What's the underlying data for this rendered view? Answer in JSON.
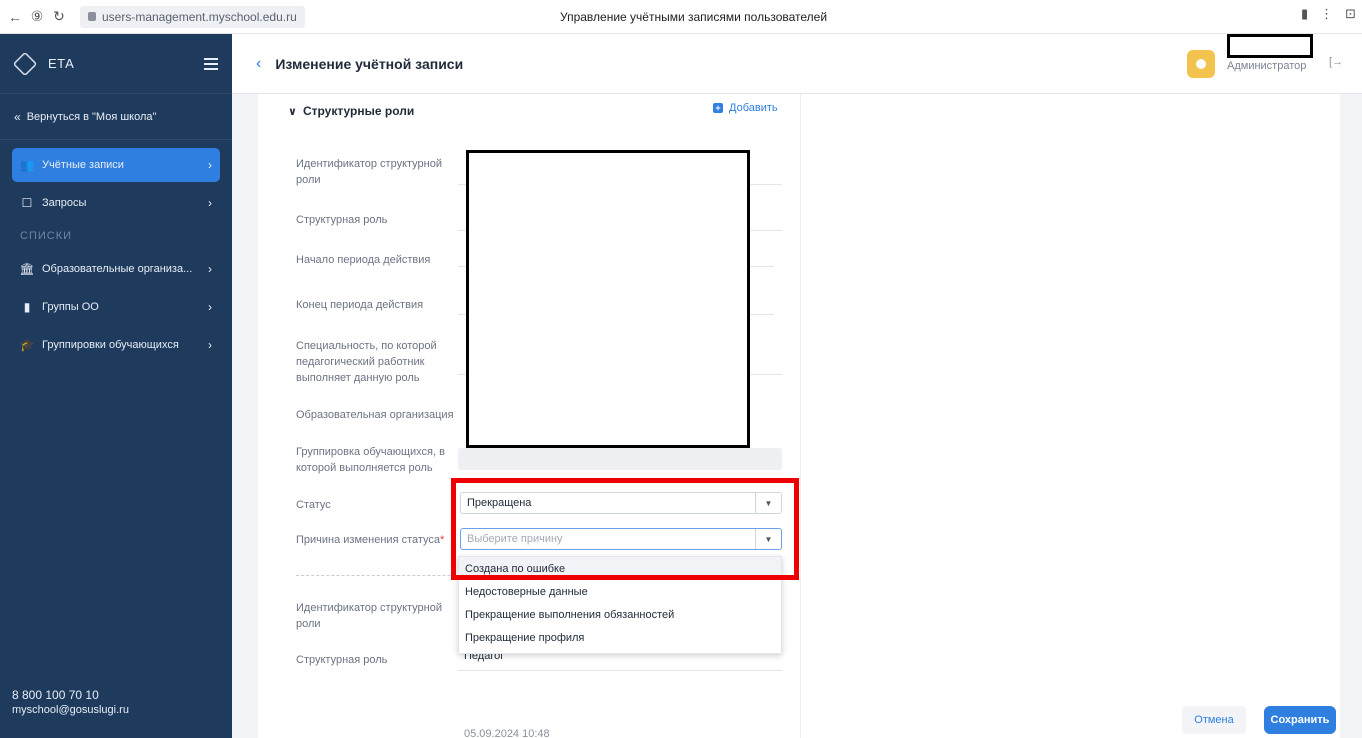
{
  "browser": {
    "url": "users-management.myschool.edu.ru",
    "title": "Управление учётными записями пользователей"
  },
  "sidebar": {
    "logo_text": "ЕТА",
    "back_link": "Вернуться в \"Моя школа\"",
    "items": [
      {
        "label": "Учётные записи",
        "icon": "users-icon",
        "active": true
      },
      {
        "label": "Запросы",
        "icon": "inbox-icon",
        "active": false
      }
    ],
    "section_label": "СПИСКИ",
    "list_items": [
      {
        "label": "Образовательные организа...",
        "icon": "institution-icon"
      },
      {
        "label": "Группы ОО",
        "icon": "bookmark-icon"
      },
      {
        "label": "Группировки обучающихся",
        "icon": "graduation-cap-icon"
      }
    ],
    "contacts": {
      "phone": "8 800 100 70 10",
      "email": "myschool@gosuslugi.ru"
    }
  },
  "header": {
    "title": "Изменение учётной записи",
    "user_role": "Администратор"
  },
  "section": {
    "title": "Структурные роли",
    "add_label": "Добавить"
  },
  "fields": {
    "role_id": "Идентификатор структурной роли",
    "role": "Структурная роль",
    "start": "Начало периода действия",
    "end": "Конец периода действия",
    "speciality": "Специальность, по которой педагогический работник выполняет данную роль",
    "organization": "Образовательная организация",
    "grouping": "Группировка обучающихся, в которой выполняется роль",
    "status": "Статус",
    "reason": "Причина изменения статуса",
    "required_mark": "*"
  },
  "status_select": {
    "value": "Прекращена"
  },
  "reason_select": {
    "placeholder": "Выберите причину"
  },
  "reason_options": [
    "Создана по ошибке",
    "Недостоверные данные",
    "Прекращение выполнения обязанностей",
    "Прекращение профиля"
  ],
  "second_role": {
    "role_id_label": "Идентификатор структурной роли",
    "role_label": "Структурная роль",
    "role_value": "Педагог",
    "partial_value": "05.09.2024 10:48"
  },
  "actions": {
    "cancel": "Отмена",
    "save": "Сохранить"
  },
  "colors": {
    "sidebar_bg": "#1e3a5c",
    "accent": "#2f7fe0",
    "highlight": "#ee0000"
  }
}
